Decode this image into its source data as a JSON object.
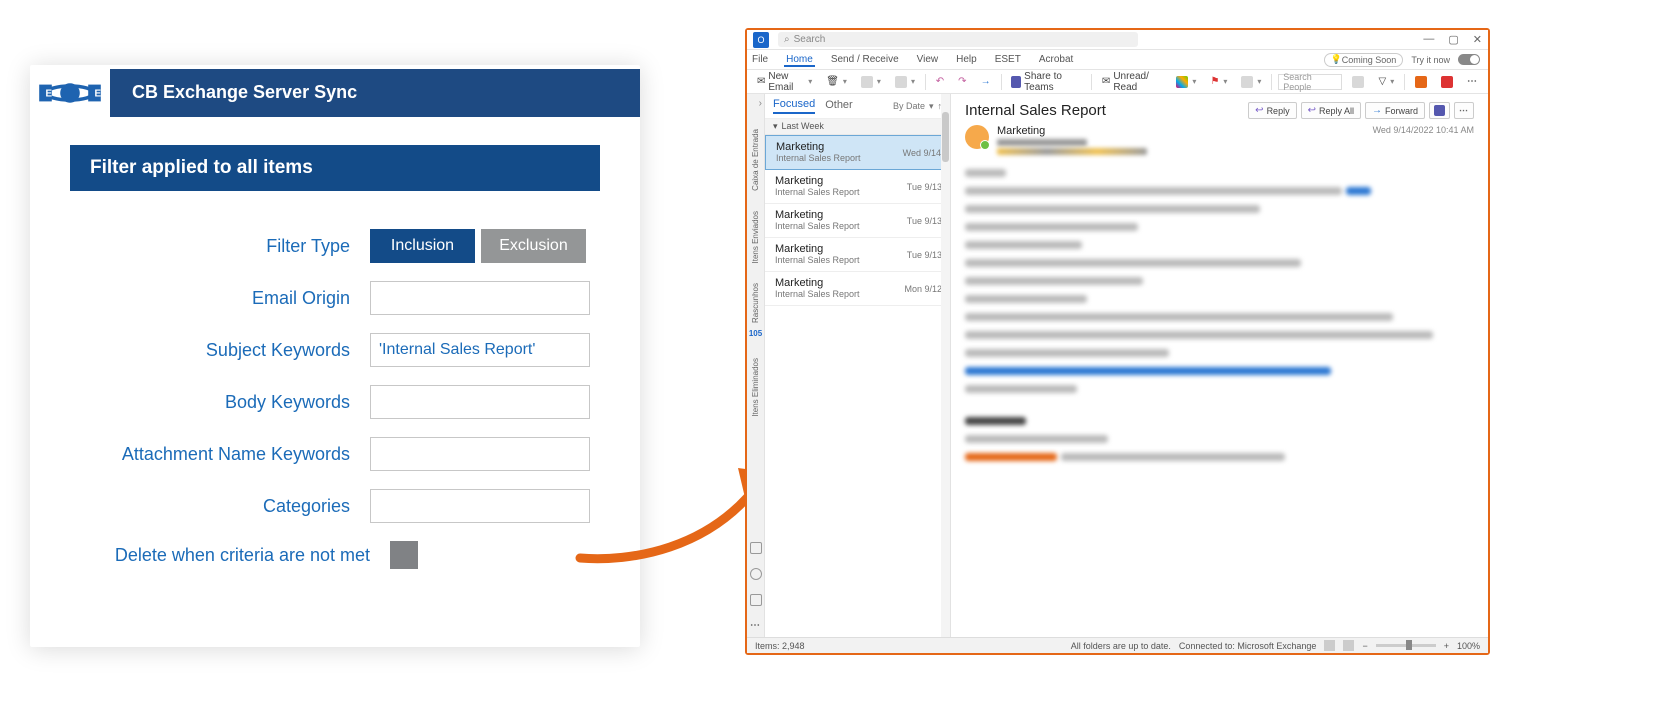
{
  "leftPanel": {
    "headerTitle": "CB Exchange Server Sync",
    "filterBar": "Filter applied to all items",
    "rows": {
      "filterTypeLabel": "Filter Type",
      "inclusion": "Inclusion",
      "exclusion": "Exclusion",
      "emailOrigin": "Email Origin",
      "subjectKeywords": "Subject Keywords",
      "subjectValue": "'Internal Sales Report'",
      "bodyKeywords": "Body Keywords",
      "attachmentKeywords": "Attachment Name Keywords",
      "categories": "Categories",
      "deleteLabel": "Delete when criteria are not met"
    }
  },
  "outlook": {
    "searchPlaceholder": "Search",
    "menus": {
      "file": "File",
      "home": "Home",
      "sendReceive": "Send / Receive",
      "view": "View",
      "help": "Help",
      "eset": "ESET",
      "acrobat": "Acrobat",
      "comingSoon": "Coming Soon",
      "tryNow": "Try it now"
    },
    "toolbar": {
      "newEmail": "New Email",
      "shareTeams": "Share to Teams",
      "unreadRead": "Unread/ Read",
      "searchPeople": "Search People"
    },
    "list": {
      "focused": "Focused",
      "other": "Other",
      "byDate": "By Date",
      "section": "Last Week",
      "items": [
        {
          "from": "Marketing",
          "subj": "Internal Sales Report",
          "date": "Wed 9/14"
        },
        {
          "from": "Marketing",
          "subj": "Internal Sales Report",
          "date": "Tue 9/13"
        },
        {
          "from": "Marketing",
          "subj": "Internal Sales Report",
          "date": "Tue 9/13"
        },
        {
          "from": "Marketing",
          "subj": "Internal Sales Report",
          "date": "Tue 9/13"
        },
        {
          "from": "Marketing",
          "subj": "Internal Sales Report",
          "date": "Mon 9/12"
        }
      ]
    },
    "rail": {
      "inbox": "Caixa de Entrada",
      "sent": "Itens Enviados",
      "drafts": "Rascunhos",
      "deleted": "Itens Eliminados",
      "deletedCount": "105"
    },
    "reading": {
      "subject": "Internal Sales Report",
      "sender": "Marketing",
      "timestamp": "Wed 9/14/2022 10:41 AM",
      "reply": "Reply",
      "replyAll": "Reply All",
      "forward": "Forward"
    },
    "status": {
      "items": "Items: 2,948",
      "folders": "All folders are up to date.",
      "connected": "Connected to: Microsoft Exchange",
      "zoom": "100%"
    }
  }
}
